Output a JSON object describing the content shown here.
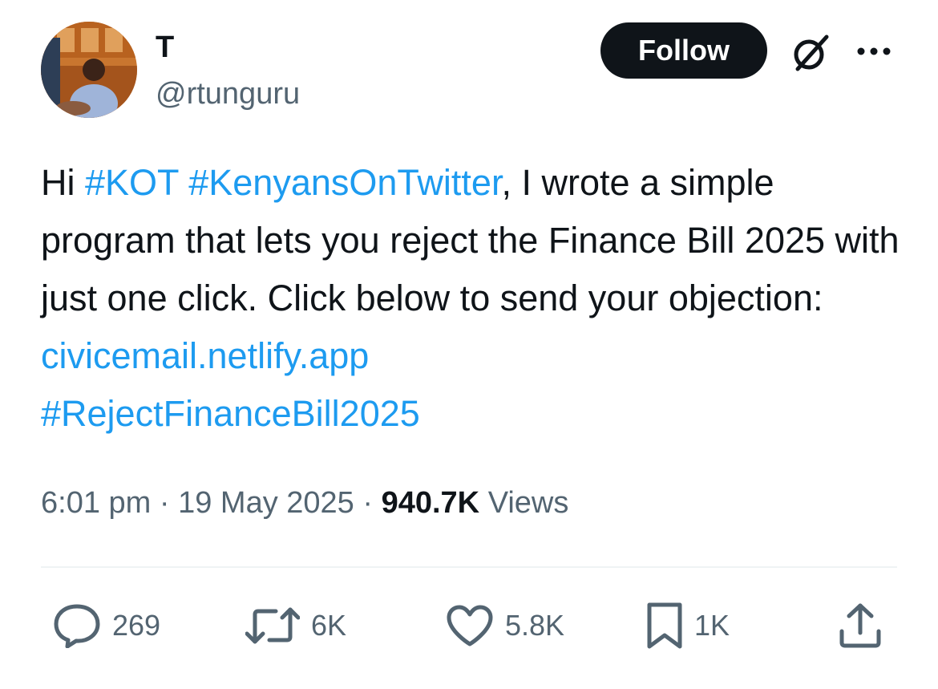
{
  "author": {
    "display_name": "T",
    "handle": "@rtunguru"
  },
  "header": {
    "follow_label": "Follow",
    "grok_icon": "grok-slash-icon",
    "more_icon": "more-dots-icon"
  },
  "tweet": {
    "text_parts": {
      "greeting": "Hi ",
      "hashtag_kot": "#KOT",
      "space1": " ",
      "hashtag_kenyans": "#KenyansOnTwitter",
      "body": ", I wrote a simple program that lets you reject the Finance Bill 2025 with just one click. Click below to send your objection: ",
      "link": "civicemail.netlify.app",
      "hashtag_reject": "#RejectFinanceBill2025"
    }
  },
  "meta": {
    "time": "6:01 pm",
    "separator": " · ",
    "date": "19 May 2025",
    "views_count": "940.7K",
    "views_label": " Views"
  },
  "actions": {
    "replies": "269",
    "reposts": "6K",
    "likes": "5.8K",
    "bookmarks": "1K"
  },
  "colors": {
    "link": "#1d9bf0",
    "secondary_text": "#536471",
    "primary_text": "#0f1419"
  }
}
